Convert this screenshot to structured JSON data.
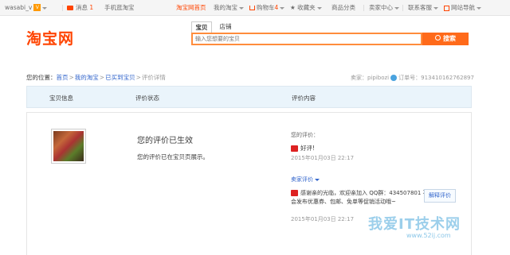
{
  "topbar": {
    "username": "wasabi_v",
    "level": "V",
    "messages_label": "消息",
    "messages_count": "1",
    "mobile_label": "手机逛淘宝",
    "home_label": "淘宝网首页",
    "my_taobao": "我的淘宝",
    "cart_label": "购物车",
    "cart_count": "4",
    "favorites_label": "收藏夹",
    "categories_label": "商品分类",
    "seller_center": "卖家中心",
    "support_label": "联系客服",
    "sitemap_label": "网站导航"
  },
  "header": {
    "logo": "淘宝网",
    "tabs": [
      "宝贝",
      "店铺"
    ],
    "search_placeholder": "输入您想要的宝贝",
    "search_button": "搜索"
  },
  "breadcrumb": {
    "prefix": "您的位置：",
    "items": [
      "首页",
      "我的淘宝",
      "已买到宝贝"
    ],
    "current": "评价详情",
    "seller_label": "卖家：",
    "seller_name": "pipibozi",
    "order_label": "订单号：",
    "order_no": "913410162762897"
  },
  "table": {
    "headers": [
      "宝贝信息",
      "评价状态",
      "评价内容"
    ]
  },
  "review": {
    "status_title": "您的评价已生效",
    "status_desc": "您的评价已在宝贝页展示。",
    "my_review_label": "您的评价：",
    "rating_text": "好评!",
    "review_date": "2015年01月03日 22:17",
    "seller_review_label": "卖家评价",
    "seller_reply": "感谢亲的光临，欢迎亲加入 QQ群：434507801 不定时会发布优惠券、包邮、免单等促销活动哦~",
    "reply_date": "2015年01月03日 22:17",
    "explain_button": "解释评价"
  },
  "watermark": {
    "title": "我爱IT技术网",
    "url": "www.52ij.com"
  }
}
